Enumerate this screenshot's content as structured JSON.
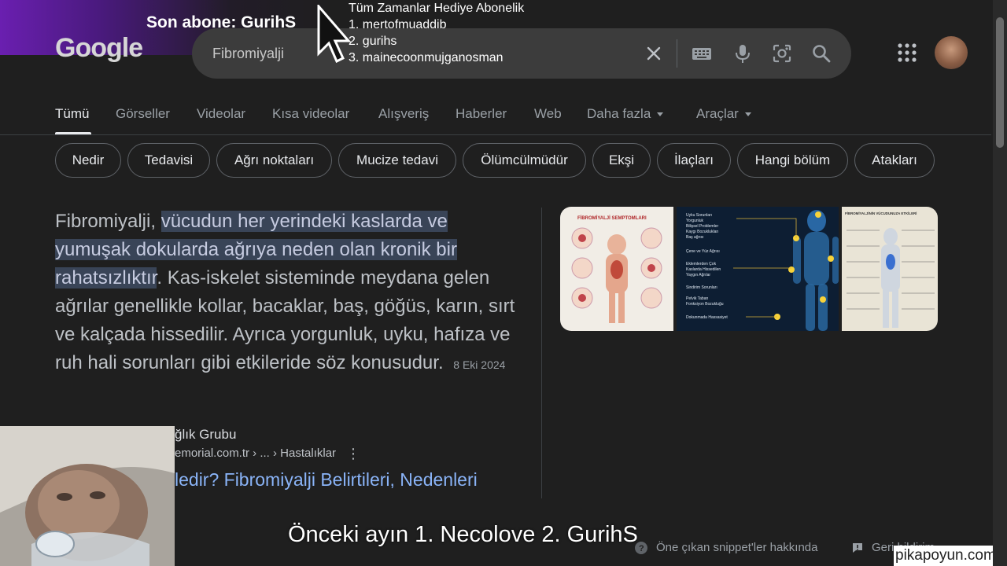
{
  "logo": {
    "text": "Google"
  },
  "search": {
    "value": "Fibromiyalji"
  },
  "overlay": {
    "last_sub": "Son abone: GurihS",
    "gift_title": "Tüm Zamanlar Hediye  Abonelik",
    "gift_list": [
      "1. mertofmuaddib",
      "2. gurihs",
      "3. mainecoonmujganosman"
    ]
  },
  "tabs": [
    {
      "label": "Tümü",
      "active": true
    },
    {
      "label": "Görseller"
    },
    {
      "label": "Videolar"
    },
    {
      "label": "Kısa videolar"
    },
    {
      "label": "Alışveriş"
    },
    {
      "label": "Haberler"
    },
    {
      "label": "Web"
    },
    {
      "label": "Daha fazla"
    },
    {
      "label": "Araçlar"
    }
  ],
  "chips": [
    "Nedir",
    "Tedavisi",
    "Ağrı noktaları",
    "Mucize tedavi",
    "Ölümcülmüdür",
    "Ekşi",
    "İlaçları",
    "Hangi bölüm",
    "Atakları"
  ],
  "snippet": {
    "lead": "Fibromiyalji, ",
    "highlight": "vücudun her yerindeki kaslarda ve yumuşak dokularda ağrıya neden olan kronik bir rahatsızlıktır",
    "rest": ". Kas-iskelet sisteminde meydana gelen ağrılar genellikle kollar, bacaklar, baş, göğüs, karın, sırt ve kalçada hissedilir. Ayrıca yorgunluk, uyku, hafıza ve ruh hali sorunları gibi etkileride söz konusudur.",
    "date": "8 Eki 2024"
  },
  "images": {
    "img1_title": "FİBROMİYALJİ SEMPTOMLARI",
    "img3_title": "FİBROMİYALJİNİN VÜCUDUNUZA ETKİLERİ",
    "img2_labels": [
      "Uyku Sorunları",
      "Yorgunluk",
      "Bilişsel Problemler",
      "Kaygı Bozuklukları",
      "Baş ağrısı",
      "Çene ve Yüz Ağrısı",
      "Eklemlerden Çok",
      "Kaslarda Hissedilen",
      "Yaygın Ağrılar",
      "Sindirim Sorunları",
      "Pelvik Taban",
      "Fonksiyon Bozukluğu",
      "Dokunmada Hassasiyet"
    ]
  },
  "source": {
    "name": "ğlık Grubu",
    "url": "emorial.com.tr › ... › Hastalıklar",
    "title": "ledir? Fibromiyalji Belirtileri, Nedenleri"
  },
  "subtitle": "Önceki ayın 1. Necolove 2. GurihS",
  "footer": {
    "about": "Öne çıkan snippet'ler hakkında",
    "feedback": "Geri bildirim"
  },
  "watermark": "pikapoyun.com",
  "colors": {
    "bg": "#1f1f1f",
    "link": "#8ab4f8",
    "highlight": "#394457"
  }
}
